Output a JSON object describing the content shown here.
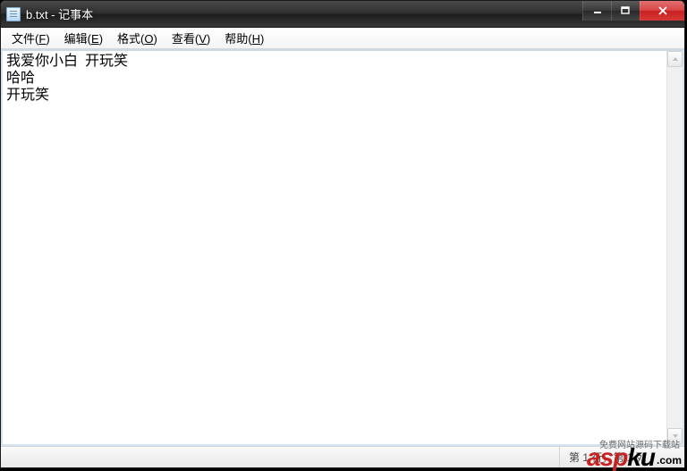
{
  "window": {
    "title": "b.txt - 记事本"
  },
  "menu": {
    "file": {
      "label": "文件",
      "key": "F"
    },
    "edit": {
      "label": "编辑",
      "key": "E"
    },
    "format": {
      "label": "格式",
      "key": "O"
    },
    "view": {
      "label": "查看",
      "key": "V"
    },
    "help": {
      "label": "帮助",
      "key": "H"
    }
  },
  "content": {
    "text": "我爱你小白  开玩笑\n哈哈\n开玩笑"
  },
  "status": {
    "position": "第 1 行，第 1 列"
  },
  "watermark": {
    "brand_prefix": "asp",
    "brand_suffix": "ku",
    "tld": ".com",
    "cn": "免费网站源码下载站"
  }
}
